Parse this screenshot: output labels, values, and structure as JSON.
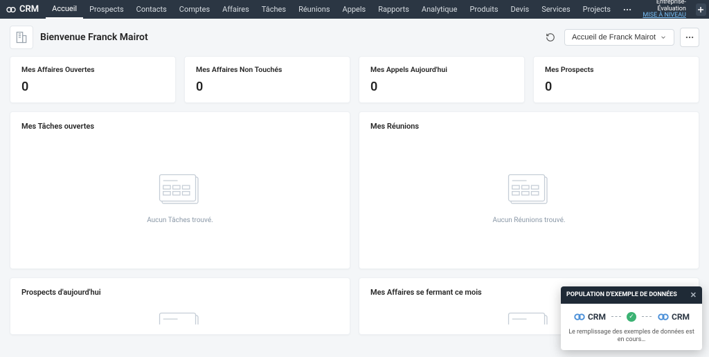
{
  "brand": "CRM",
  "nav": {
    "items": [
      "Accueil",
      "Prospects",
      "Contacts",
      "Comptes",
      "Affaires",
      "Tâches",
      "Réunions",
      "Appels",
      "Rapports",
      "Analytique",
      "Produits",
      "Devis",
      "Services",
      "Projects"
    ],
    "active_index": 0
  },
  "trial": {
    "label": "Entreprise-Évaluation",
    "upgrade": "MISE À NIVEAU"
  },
  "header": {
    "welcome": "Bienvenue Franck Mairot",
    "view_button": "Accueil de Franck Mairot"
  },
  "stats": [
    {
      "label": "Mes Affaires Ouvertes",
      "value": "0"
    },
    {
      "label": "Mes Affaires Non Touchés",
      "value": "0"
    },
    {
      "label": "Mes Appels Aujourd'hui",
      "value": "0"
    },
    {
      "label": "Mes Prospects",
      "value": "0"
    }
  ],
  "panels": [
    {
      "title": "Mes Tâches ouvertes",
      "empty": "Aucun Tâches trouvé."
    },
    {
      "title": "Mes Réunions",
      "empty": "Aucun Réunions trouvé."
    },
    {
      "title": "Prospects d'aujourd'hui",
      "empty": ""
    },
    {
      "title": "Mes Affaires se fermant ce mois",
      "empty": ""
    }
  ],
  "toast": {
    "title": "POPULATION D'EXEMPLE DE DONNÉES",
    "brand": "CRM",
    "message": "Le remplissage des exemples de données est en cours…"
  }
}
